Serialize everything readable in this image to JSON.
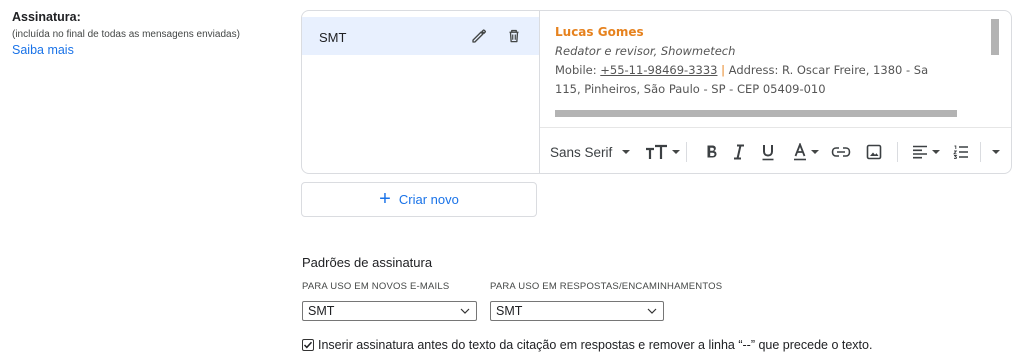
{
  "left": {
    "title": "Assinatura:",
    "subtitle": "(incluída no final de todas as mensagens enviadas)",
    "link": "Saiba mais"
  },
  "signatures": {
    "items": [
      {
        "name": "SMT",
        "selected": true
      }
    ]
  },
  "editor": {
    "name": "Lucas Gomes",
    "role": "Redator e revisor, Showmetech",
    "mobile_label": "Mobile: ",
    "phone": "+55-11-98469-3333",
    "separator": " | ",
    "address_line": "Address: R. Oscar Freire, 1380 - Sa",
    "address_line2": "115, Pinheiros, São Paulo - SP - CEP 05409-010",
    "toolbar": {
      "font": "Sans Serif"
    }
  },
  "create_button": {
    "label": "Criar novo"
  },
  "defaults": {
    "title": "Padrões de assinatura",
    "new_caption": "PARA USO EM NOVOS E-MAILS",
    "new_value": "SMT",
    "reply_caption": "PARA USO EM RESPOSTAS/ENCAMINHAMENTOS",
    "reply_value": "SMT",
    "checkbox_label": "Inserir assinatura antes do texto da citação em respostas e remover a linha “--” que precede o texto.",
    "checkbox_checked": true
  },
  "colors": {
    "accent": "#1a73e8",
    "selected_bg": "#e8f0fe",
    "signature_name": "#e6821e"
  }
}
